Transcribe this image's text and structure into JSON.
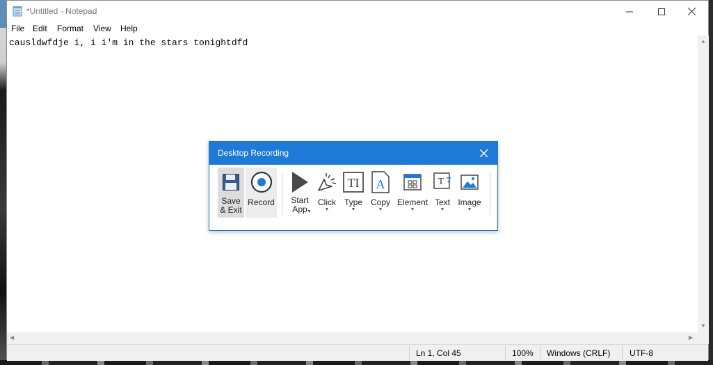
{
  "window": {
    "title": "*Untitled - Notepad",
    "controls": {
      "minimize": "—",
      "maximize": "☐",
      "close": "✕"
    }
  },
  "menu": [
    "File",
    "Edit",
    "Format",
    "View",
    "Help"
  ],
  "editor": {
    "content": "causldwfdje i, i i'm in the stars tonightdfd"
  },
  "status": {
    "position": "Ln 1, Col 45",
    "zoom": "100%",
    "line_ending": "Windows (CRLF)",
    "encoding": "UTF-8"
  },
  "dialog": {
    "title": "Desktop Recording",
    "tools": {
      "save_exit": "Save\n& Exit",
      "record": "Record",
      "start_app": "Start\nApp",
      "click": "Click",
      "type": "Type",
      "copy": "Copy",
      "element": "Element",
      "text": "Text",
      "image": "Image"
    }
  },
  "colors": {
    "accent": "#1e7ad6",
    "selected_bg": "#dcdcdc"
  }
}
